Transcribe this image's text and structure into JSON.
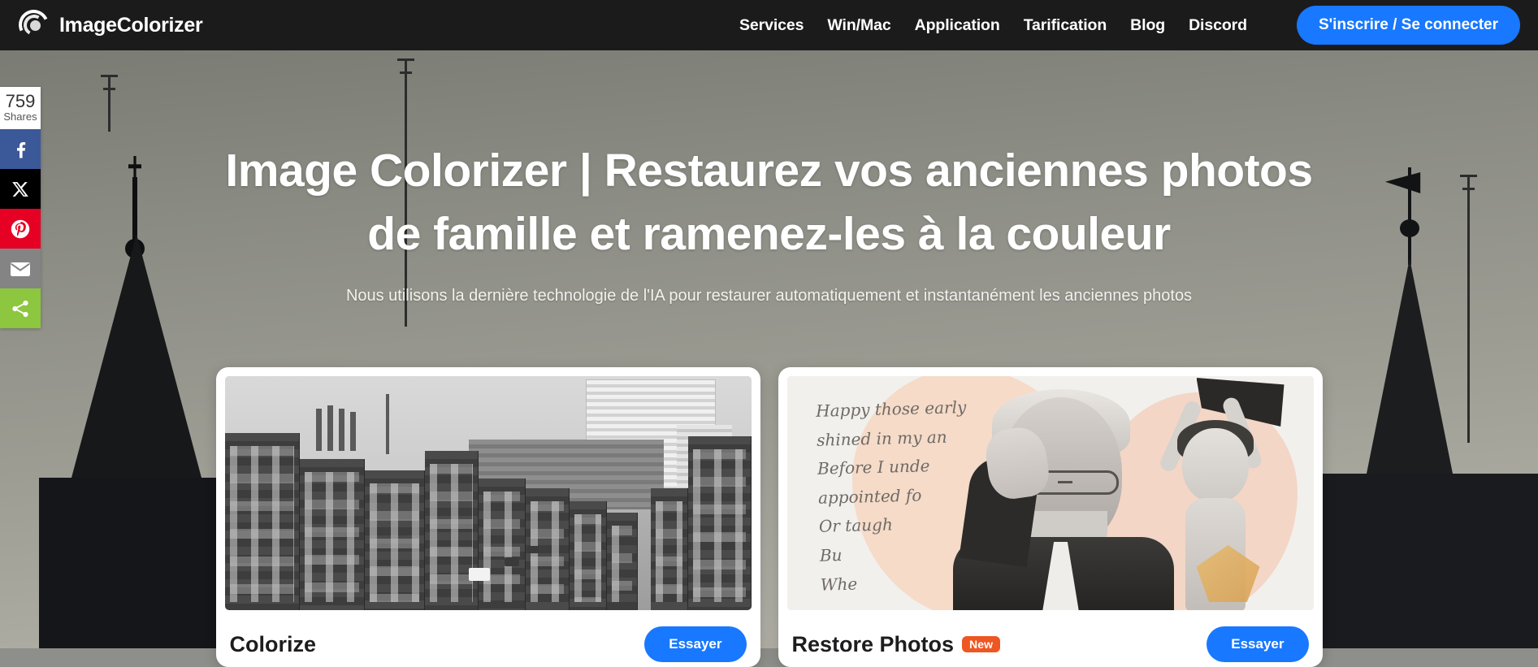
{
  "header": {
    "logo_text": "ImageColorizer",
    "logo_icon": "swirl-logo-icon",
    "nav_items": [
      {
        "label": "Services"
      },
      {
        "label": "Win/Mac"
      },
      {
        "label": "Application"
      },
      {
        "label": "Tarification"
      },
      {
        "label": "Blog"
      },
      {
        "label": "Discord"
      }
    ],
    "signup_label": "S'inscrire / Se connecter",
    "accent_color": "#1878ff",
    "background_color": "#1b1b1b"
  },
  "share_rail": {
    "count": "759",
    "count_label": "Shares",
    "buttons": [
      {
        "name": "facebook",
        "icon": "facebook-icon",
        "color": "#3b5998"
      },
      {
        "name": "x-twitter",
        "icon": "x-twitter-icon",
        "color": "#000000"
      },
      {
        "name": "pinterest",
        "icon": "pinterest-icon",
        "color": "#e60023"
      },
      {
        "name": "email",
        "icon": "email-icon",
        "color": "#848484"
      },
      {
        "name": "more-share",
        "icon": "share-nodes-icon",
        "color": "#8dc63f"
      }
    ]
  },
  "hero": {
    "title": "Image Colorizer | Restaurez vos anciennes photos de famille et ramenez-les à la couleur",
    "subtitle": "Nous utilisons la dernière technologie de l'IA pour restaurer automatiquement et instantanément les anciennes photos"
  },
  "cards": [
    {
      "title": "Colorize",
      "badge": "",
      "button_label": "Essayer",
      "image_alt": "Photo noir et blanc d'une rue de ville ancienne",
      "button_color": "#1878ff"
    },
    {
      "title": "Restore Photos",
      "badge": "New",
      "badge_color": "#ee5622",
      "button_label": "Essayer",
      "image_alt": "Collage de photos restaurées : homme âgé et jeune garçon",
      "button_color": "#1878ff",
      "script_lines": [
        "Happy those early",
        "shined in my an",
        "Before I unde",
        "appointed fo",
        "Or taugh",
        "Bu",
        "Whe"
      ]
    }
  ]
}
